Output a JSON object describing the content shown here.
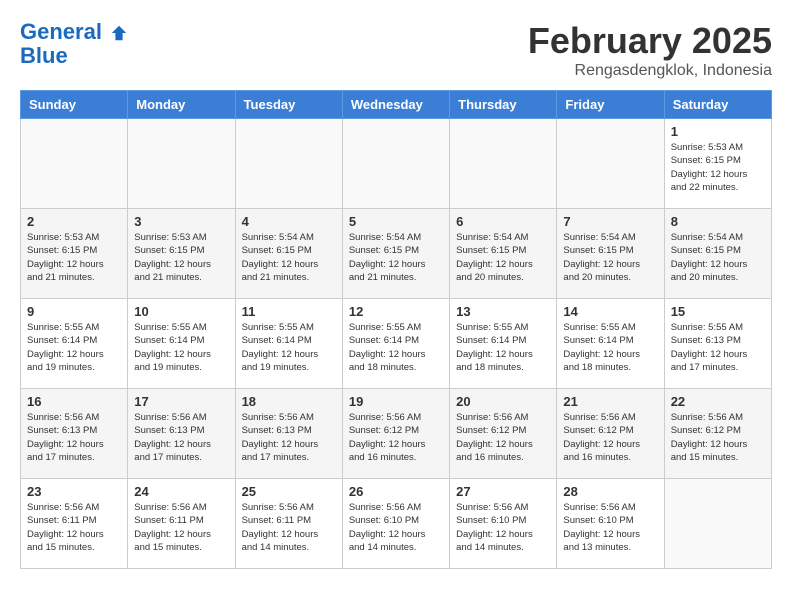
{
  "header": {
    "logo_line1": "General",
    "logo_line2": "Blue",
    "month": "February 2025",
    "location": "Rengasdengklok, Indonesia"
  },
  "days_of_week": [
    "Sunday",
    "Monday",
    "Tuesday",
    "Wednesday",
    "Thursday",
    "Friday",
    "Saturday"
  ],
  "weeks": [
    [
      {
        "day": "",
        "info": ""
      },
      {
        "day": "",
        "info": ""
      },
      {
        "day": "",
        "info": ""
      },
      {
        "day": "",
        "info": ""
      },
      {
        "day": "",
        "info": ""
      },
      {
        "day": "",
        "info": ""
      },
      {
        "day": "1",
        "info": "Sunrise: 5:53 AM\nSunset: 6:15 PM\nDaylight: 12 hours\nand 22 minutes."
      }
    ],
    [
      {
        "day": "2",
        "info": "Sunrise: 5:53 AM\nSunset: 6:15 PM\nDaylight: 12 hours\nand 21 minutes."
      },
      {
        "day": "3",
        "info": "Sunrise: 5:53 AM\nSunset: 6:15 PM\nDaylight: 12 hours\nand 21 minutes."
      },
      {
        "day": "4",
        "info": "Sunrise: 5:54 AM\nSunset: 6:15 PM\nDaylight: 12 hours\nand 21 minutes."
      },
      {
        "day": "5",
        "info": "Sunrise: 5:54 AM\nSunset: 6:15 PM\nDaylight: 12 hours\nand 21 minutes."
      },
      {
        "day": "6",
        "info": "Sunrise: 5:54 AM\nSunset: 6:15 PM\nDaylight: 12 hours\nand 20 minutes."
      },
      {
        "day": "7",
        "info": "Sunrise: 5:54 AM\nSunset: 6:15 PM\nDaylight: 12 hours\nand 20 minutes."
      },
      {
        "day": "8",
        "info": "Sunrise: 5:54 AM\nSunset: 6:15 PM\nDaylight: 12 hours\nand 20 minutes."
      }
    ],
    [
      {
        "day": "9",
        "info": "Sunrise: 5:55 AM\nSunset: 6:14 PM\nDaylight: 12 hours\nand 19 minutes."
      },
      {
        "day": "10",
        "info": "Sunrise: 5:55 AM\nSunset: 6:14 PM\nDaylight: 12 hours\nand 19 minutes."
      },
      {
        "day": "11",
        "info": "Sunrise: 5:55 AM\nSunset: 6:14 PM\nDaylight: 12 hours\nand 19 minutes."
      },
      {
        "day": "12",
        "info": "Sunrise: 5:55 AM\nSunset: 6:14 PM\nDaylight: 12 hours\nand 18 minutes."
      },
      {
        "day": "13",
        "info": "Sunrise: 5:55 AM\nSunset: 6:14 PM\nDaylight: 12 hours\nand 18 minutes."
      },
      {
        "day": "14",
        "info": "Sunrise: 5:55 AM\nSunset: 6:14 PM\nDaylight: 12 hours\nand 18 minutes."
      },
      {
        "day": "15",
        "info": "Sunrise: 5:55 AM\nSunset: 6:13 PM\nDaylight: 12 hours\nand 17 minutes."
      }
    ],
    [
      {
        "day": "16",
        "info": "Sunrise: 5:56 AM\nSunset: 6:13 PM\nDaylight: 12 hours\nand 17 minutes."
      },
      {
        "day": "17",
        "info": "Sunrise: 5:56 AM\nSunset: 6:13 PM\nDaylight: 12 hours\nand 17 minutes."
      },
      {
        "day": "18",
        "info": "Sunrise: 5:56 AM\nSunset: 6:13 PM\nDaylight: 12 hours\nand 17 minutes."
      },
      {
        "day": "19",
        "info": "Sunrise: 5:56 AM\nSunset: 6:12 PM\nDaylight: 12 hours\nand 16 minutes."
      },
      {
        "day": "20",
        "info": "Sunrise: 5:56 AM\nSunset: 6:12 PM\nDaylight: 12 hours\nand 16 minutes."
      },
      {
        "day": "21",
        "info": "Sunrise: 5:56 AM\nSunset: 6:12 PM\nDaylight: 12 hours\nand 16 minutes."
      },
      {
        "day": "22",
        "info": "Sunrise: 5:56 AM\nSunset: 6:12 PM\nDaylight: 12 hours\nand 15 minutes."
      }
    ],
    [
      {
        "day": "23",
        "info": "Sunrise: 5:56 AM\nSunset: 6:11 PM\nDaylight: 12 hours\nand 15 minutes."
      },
      {
        "day": "24",
        "info": "Sunrise: 5:56 AM\nSunset: 6:11 PM\nDaylight: 12 hours\nand 15 minutes."
      },
      {
        "day": "25",
        "info": "Sunrise: 5:56 AM\nSunset: 6:11 PM\nDaylight: 12 hours\nand 14 minutes."
      },
      {
        "day": "26",
        "info": "Sunrise: 5:56 AM\nSunset: 6:10 PM\nDaylight: 12 hours\nand 14 minutes."
      },
      {
        "day": "27",
        "info": "Sunrise: 5:56 AM\nSunset: 6:10 PM\nDaylight: 12 hours\nand 14 minutes."
      },
      {
        "day": "28",
        "info": "Sunrise: 5:56 AM\nSunset: 6:10 PM\nDaylight: 12 hours\nand 13 minutes."
      },
      {
        "day": "",
        "info": ""
      }
    ]
  ]
}
